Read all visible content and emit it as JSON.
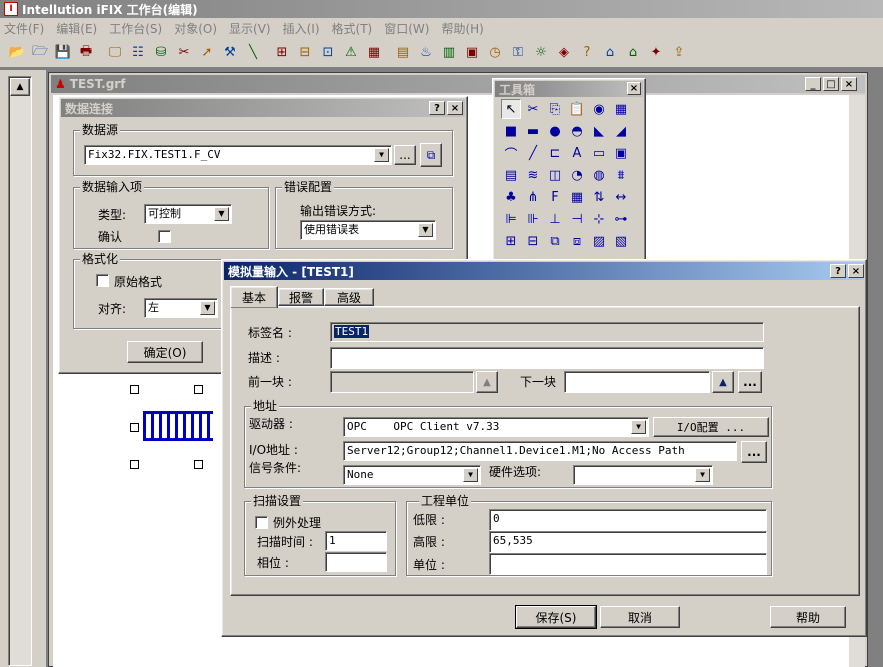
{
  "app": {
    "title": "Intellution iFIX 工作台(编辑)"
  },
  "menu": [
    "文件(F)",
    "编辑(E)",
    "工作台(S)",
    "对象(O)",
    "显示(V)",
    "插入(I)",
    "格式(T)",
    "窗口(W)",
    "帮助(H)"
  ],
  "toolbar_icons": [
    "open-icon",
    "open-folder-icon",
    "save-icon",
    "print-icon",
    "monitor-icon",
    "properties-icon",
    "database-icon",
    "cut-icon",
    "run-icon",
    "tools-icon",
    "line-icon",
    "new-tag-icon",
    "tag-group-icon",
    "tag-icon",
    "alarm-icon",
    "pattern-icon",
    "chart-icon",
    "bottle-icon",
    "doc-icon",
    "db-manager-icon",
    "schedule-icon",
    "key-icon",
    "bulb-icon",
    "logo-icon",
    "help-icon",
    "home-icon",
    "home2-icon",
    "star-icon",
    "export-icon"
  ],
  "doc": {
    "title": "TEST.grf"
  },
  "toolbox": {
    "title": "工具箱",
    "tools": [
      "pointer-icon",
      "cut-tool-icon",
      "copy-tool-icon",
      "paste-tool-icon",
      "clock-icon",
      "calendar-icon",
      "rectangle-icon",
      "rounded-rect-icon",
      "ellipse-icon",
      "chord-icon",
      "pie-icon",
      "arc-icon",
      "curve-icon",
      "line-tool-icon",
      "polyline-icon",
      "text-tool-icon",
      "button-tool-icon",
      "bitmap-icon",
      "datalink-icon",
      "alarm-summary-icon",
      "shape-icon",
      "timer-icon",
      "gauge-icon",
      "trend-icon",
      "event-icon",
      "variable-icon",
      "font-icon",
      "grid-icon",
      "sort-icon",
      "resize-icon",
      "align-left-icon",
      "align-center-icon",
      "align-bottom-icon",
      "align-middle-icon",
      "space-icon",
      "distribute-icon",
      "group-icon",
      "ungroup-icon",
      "bring-front-icon",
      "send-back-icon",
      "layer-icon",
      "layer2-icon"
    ]
  },
  "datalink": {
    "title": "数据连接",
    "source_label": "数据源",
    "source_value": "Fix32.FIX.TEST1.F_CV",
    "browse_btn": "...",
    "input_group": "数据输入项",
    "type_label": "类型:",
    "type_value": "可控制",
    "confirm_label": "确认",
    "error_group": "错误配置",
    "error_mode_label": "输出错误方式:",
    "error_mode_value": "使用错误表",
    "format_group": "格式化",
    "raw_format_label": "原始格式",
    "align_label": "对齐:",
    "align_value": "左",
    "ok_btn": "确定(O)"
  },
  "aidialog": {
    "title": "模拟量输入 - [TEST1]",
    "tabs": [
      "基本",
      "报警",
      "高级"
    ],
    "tag_label": "标签名 :",
    "tag_value": "TEST1",
    "desc_label": "描述 :",
    "desc_value": "",
    "prev_label": "前一块 :",
    "next_label": "下一块",
    "prev_value": "",
    "next_value": "",
    "address_group": "地址",
    "driver_label": "驱动器 :",
    "driver_value": "OPC    OPC Client v7.33",
    "io_config_btn": "I/O配置 ...",
    "io_addr_label": "I/O地址 :",
    "io_addr_value": "Server12;Group12;Channel1.Device1.M1;No Access Path",
    "signal_label": "信号条件:",
    "signal_value": "None",
    "hw_label": "硬件选项:",
    "hw_value": "",
    "scan_group": "扫描设置",
    "exception_label": "例外处理",
    "scan_time_label": "扫描时间 :",
    "scan_time_value": "1",
    "phase_label": "相位 :",
    "phase_value": "",
    "eu_group": "工程单位",
    "low_label": "低限 :",
    "low_value": "0",
    "high_label": "高限 :",
    "high_value": "65,535",
    "unit_label": "单位 :",
    "unit_value": "",
    "save_btn": "保存(S)",
    "cancel_btn": "取消",
    "help_btn": "帮助",
    "more_btn": "...",
    "dd": "▼",
    "up": "▲"
  }
}
